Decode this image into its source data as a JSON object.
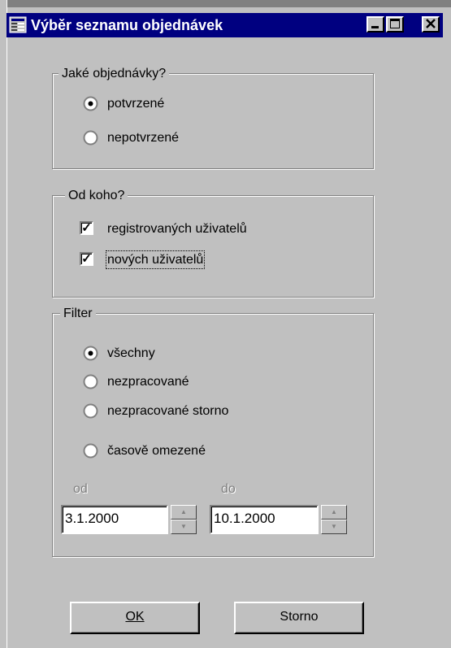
{
  "window": {
    "title": "Výběr seznamu objednávek",
    "icon": "list-form-icon",
    "controls": {
      "minimize": "minimize-icon",
      "maximize": "maximize-icon",
      "close": "close-icon"
    }
  },
  "group_orders": {
    "legend": "Jaké objednávky?",
    "options": [
      {
        "label": "potvrzené",
        "selected": true
      },
      {
        "label": "nepotvrzené",
        "selected": false
      }
    ]
  },
  "group_from": {
    "legend": "Od koho?",
    "options": [
      {
        "label": "registrovaných uživatelů",
        "checked": true
      },
      {
        "label": "nových uživatelů",
        "checked": true
      }
    ]
  },
  "group_filter": {
    "legend": "Filter",
    "options": [
      {
        "label": "všechny",
        "selected": true
      },
      {
        "label": "nezpracované",
        "selected": false
      },
      {
        "label": "nezpracované storno",
        "selected": false
      },
      {
        "label": "časově omezené",
        "selected": false
      }
    ],
    "from_label": "od",
    "to_label": "do",
    "from_value": "3.1.2000",
    "to_value": "10.1.2000"
  },
  "buttons": {
    "ok": "OK",
    "cancel": "Storno"
  }
}
